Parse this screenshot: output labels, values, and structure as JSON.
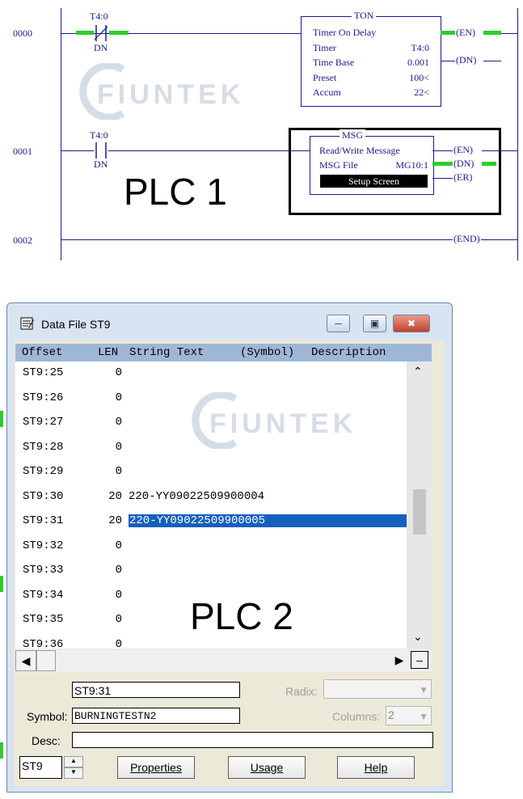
{
  "plc1": {
    "label": "PLC 1",
    "watermark": "FIUNTEK",
    "rungs": [
      {
        "number": "0000"
      },
      {
        "number": "0001"
      },
      {
        "number": "0002"
      }
    ],
    "rung0": {
      "contact_tag": "T4:0",
      "contact_bit": "DN",
      "block": {
        "name": "TON",
        "title": "Timer On Delay",
        "rows": [
          {
            "label": "Timer",
            "value": "T4:0"
          },
          {
            "label": "Time Base",
            "value": "0.001"
          },
          {
            "label": "Preset",
            "value": "100<"
          },
          {
            "label": "Accum",
            "value": "22<"
          }
        ]
      },
      "coils": [
        "EN",
        "DN"
      ]
    },
    "rung1": {
      "contact_tag": "T4:0",
      "contact_bit": "DN",
      "block": {
        "name": "MSG",
        "title": "Read/Write Message",
        "file_label": "MSG File",
        "file_value": "MG10:1",
        "setup_button": "Setup Screen"
      },
      "coils": [
        "EN",
        "DN",
        "ER"
      ]
    },
    "rung2": {
      "coil": "END"
    }
  },
  "plc2": {
    "label": "PLC 2",
    "watermark": "FIUNTEK",
    "window": {
      "title": "Data File ST9",
      "minimize_icon": "minimize-icon",
      "restore_icon": "restore-icon",
      "close_icon": "close-icon"
    },
    "columns": {
      "offset": "Offset",
      "len": "LEN",
      "text": "String Text",
      "symbol": "(Symbol)",
      "desc": "Description"
    },
    "rows": [
      {
        "offset": "ST9:25",
        "len": "0",
        "text": ""
      },
      {
        "offset": "ST9:26",
        "len": "0",
        "text": ""
      },
      {
        "offset": "ST9:27",
        "len": "0",
        "text": ""
      },
      {
        "offset": "ST9:28",
        "len": "0",
        "text": ""
      },
      {
        "offset": "ST9:29",
        "len": "0",
        "text": ""
      },
      {
        "offset": "ST9:30",
        "len": "20",
        "text": "220-YY09022509900004"
      },
      {
        "offset": "ST9:31",
        "len": "20",
        "text": "220-YY09022509900005",
        "selected": true
      },
      {
        "offset": "ST9:32",
        "len": "0",
        "text": ""
      },
      {
        "offset": "ST9:33",
        "len": "0",
        "text": ""
      },
      {
        "offset": "ST9:34",
        "len": "0",
        "text": ""
      },
      {
        "offset": "ST9:35",
        "len": "0",
        "text": ""
      },
      {
        "offset": "ST9:36",
        "len": "0",
        "text": ""
      }
    ],
    "address_value": "ST9:31",
    "radix_label": "Radix:",
    "radix_value": "",
    "symbol_label": "Symbol:",
    "symbol_value": "BURNINGTESTN2",
    "columns_label": "Columns:",
    "columns_value": "2",
    "desc_label": "Desc:",
    "desc_value": "",
    "file_value": "ST9",
    "buttons": {
      "properties": "Properties",
      "usage": "Usage",
      "help": "Help"
    }
  }
}
